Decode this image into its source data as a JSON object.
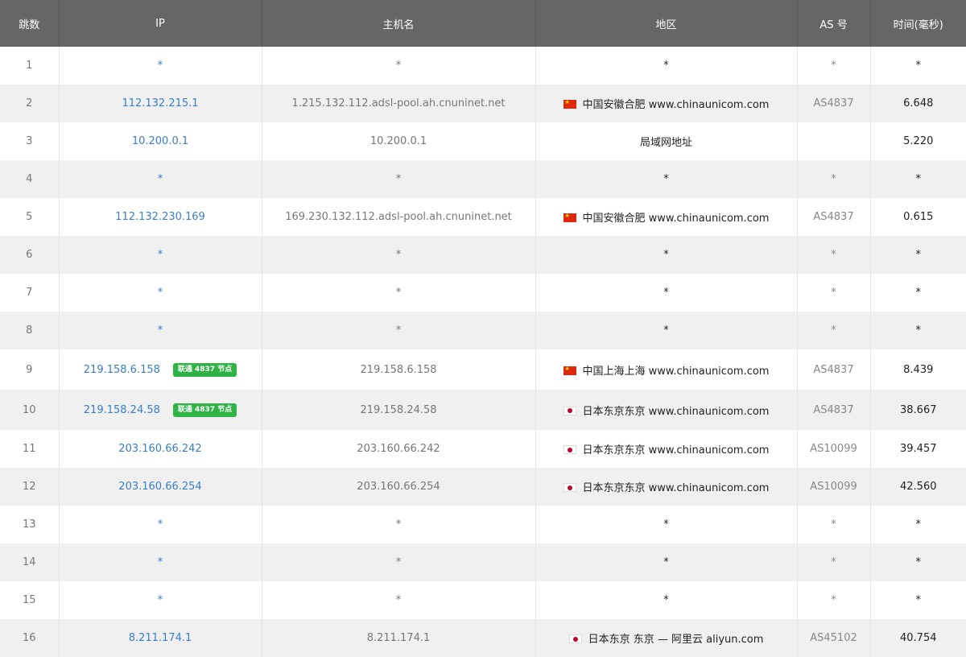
{
  "table": {
    "headers": {
      "hop": "跳数",
      "ip": "IP",
      "host": "主机名",
      "region": "地区",
      "as": "AS 号",
      "time": "时间(毫秒)"
    },
    "rows": [
      {
        "hop": "1",
        "ip": "*",
        "badge": "",
        "host": "*",
        "flag": "",
        "region": "*",
        "as": "*",
        "time": "*"
      },
      {
        "hop": "2",
        "ip": "112.132.215.1",
        "badge": "",
        "host": "1.215.132.112.adsl-pool.ah.cnuninet.net",
        "flag": "cn",
        "region": "中国安徽合肥 www.chinaunicom.com",
        "as": "AS4837",
        "time": "6.648"
      },
      {
        "hop": "3",
        "ip": "10.200.0.1",
        "badge": "",
        "host": "10.200.0.1",
        "flag": "",
        "region": "局域网地址",
        "as": "",
        "time": "5.220"
      },
      {
        "hop": "4",
        "ip": "*",
        "badge": "",
        "host": "*",
        "flag": "",
        "region": "*",
        "as": "*",
        "time": "*"
      },
      {
        "hop": "5",
        "ip": "112.132.230.169",
        "badge": "",
        "host": "169.230.132.112.adsl-pool.ah.cnuninet.net",
        "flag": "cn",
        "region": "中国安徽合肥 www.chinaunicom.com",
        "as": "AS4837",
        "time": "0.615"
      },
      {
        "hop": "6",
        "ip": "*",
        "badge": "",
        "host": "*",
        "flag": "",
        "region": "*",
        "as": "*",
        "time": "*"
      },
      {
        "hop": "7",
        "ip": "*",
        "badge": "",
        "host": "*",
        "flag": "",
        "region": "*",
        "as": "*",
        "time": "*"
      },
      {
        "hop": "8",
        "ip": "*",
        "badge": "",
        "host": "*",
        "flag": "",
        "region": "*",
        "as": "*",
        "time": "*"
      },
      {
        "hop": "9",
        "ip": "219.158.6.158",
        "badge": "联通 4837 节点",
        "host": "219.158.6.158",
        "flag": "cn",
        "region": "中国上海上海 www.chinaunicom.com",
        "as": "AS4837",
        "time": "8.439"
      },
      {
        "hop": "10",
        "ip": "219.158.24.58",
        "badge": "联通 4837 节点",
        "host": "219.158.24.58",
        "flag": "jp",
        "region": "日本东京东京 www.chinaunicom.com",
        "as": "AS4837",
        "time": "38.667"
      },
      {
        "hop": "11",
        "ip": "203.160.66.242",
        "badge": "",
        "host": "203.160.66.242",
        "flag": "jp",
        "region": "日本东京东京 www.chinaunicom.com",
        "as": "AS10099",
        "time": "39.457"
      },
      {
        "hop": "12",
        "ip": "203.160.66.254",
        "badge": "",
        "host": "203.160.66.254",
        "flag": "jp",
        "region": "日本东京东京 www.chinaunicom.com",
        "as": "AS10099",
        "time": "42.560"
      },
      {
        "hop": "13",
        "ip": "*",
        "badge": "",
        "host": "*",
        "flag": "",
        "region": "*",
        "as": "*",
        "time": "*"
      },
      {
        "hop": "14",
        "ip": "*",
        "badge": "",
        "host": "*",
        "flag": "",
        "region": "*",
        "as": "*",
        "time": "*"
      },
      {
        "hop": "15",
        "ip": "*",
        "badge": "",
        "host": "*",
        "flag": "",
        "region": "*",
        "as": "*",
        "time": "*"
      },
      {
        "hop": "16",
        "ip": "8.211.174.1",
        "badge": "",
        "host": "8.211.174.1",
        "flag": "jp",
        "region": "日本东京 东京 — 阿里云 aliyun.com",
        "as": "AS45102",
        "time": "40.754"
      }
    ]
  },
  "colors": {
    "header_bg": "#666666",
    "ip_link": "#3a7ec4",
    "badge_bg": "#2fb344",
    "row_alt": "#f0f0f0"
  }
}
